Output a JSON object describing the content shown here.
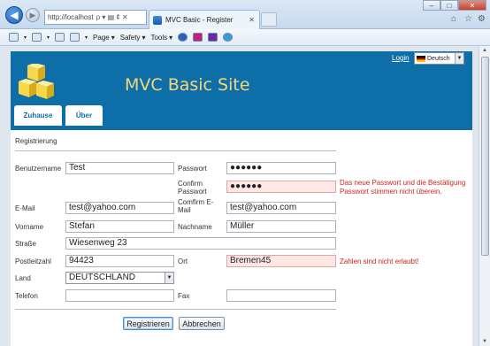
{
  "browser": {
    "address": "http://localhost",
    "address_icons": "ρ ▾ ▤ ¢ ✕",
    "tab_title": "MVC Basic - Register",
    "menus": [
      {
        "label": "Page"
      },
      {
        "label": "Safety"
      },
      {
        "label": "Tools"
      }
    ]
  },
  "header": {
    "site_title": "MVC Basic Site",
    "login_link": "Login",
    "language": "Deutsch",
    "nav": [
      {
        "label": "Zuhause"
      },
      {
        "label": "Über"
      }
    ]
  },
  "form": {
    "section_title": "Registrierung",
    "fields": {
      "benutzername": {
        "label": "Benutzername",
        "value": "Test"
      },
      "passwort": {
        "label": "Passwort",
        "value": "●●●●●●"
      },
      "confirm_passwort": {
        "label_line1": "Confirm",
        "label_line2": "Passwort",
        "value": "●●●●●●"
      },
      "email": {
        "label": "E-Mail",
        "value": "test@yahoo.com"
      },
      "confirm_email": {
        "label_line1": "Comfirm E-",
        "label_line2": "Mail",
        "value": "test@yahoo.com"
      },
      "vorname": {
        "label": "Vorname",
        "value": "Stefan"
      },
      "nachname": {
        "label": "Nachname",
        "value": "Müller"
      },
      "strasse": {
        "label": "Straße",
        "value": "Wiesenweg 23"
      },
      "postleitzahl": {
        "label": "Postleitzahl",
        "value": "94423"
      },
      "ort": {
        "label": "Ort",
        "value": "Bremen45"
      },
      "land": {
        "label": "Land",
        "value": "DEUTSCHLAND"
      },
      "telefon": {
        "label": "Telefon",
        "value": ""
      },
      "fax": {
        "label": "Fax",
        "value": ""
      }
    },
    "errors": {
      "password_line1": "Das neue Passwort und die Bestätigung",
      "password_line2": "Passwort stimmen nicht überein.",
      "ort": "Zahlen sind nicht erlaubt!"
    },
    "buttons": {
      "register": "Registrieren",
      "cancel": "Abbrechen"
    }
  },
  "colors": {
    "header_bg": "#0e6ea8",
    "title": "#f5d77a",
    "error": "#d0241c",
    "error_field_bg": "#fde8e6"
  }
}
